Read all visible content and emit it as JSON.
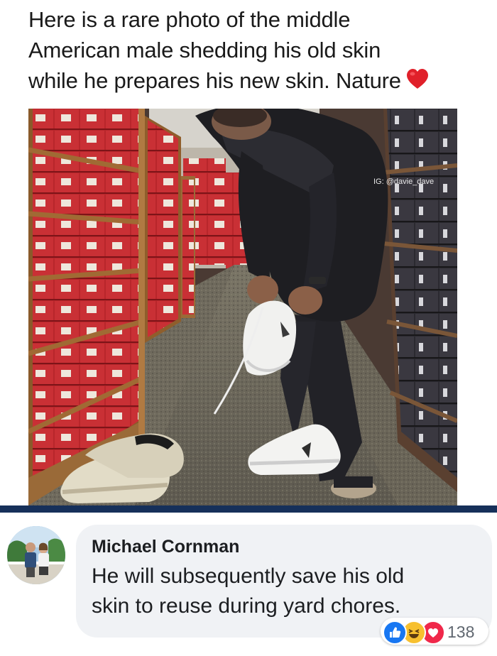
{
  "meme": {
    "caption_lines": [
      "Here is a rare photo of the middle",
      "American male shedding his old skin",
      "while he prepares his new skin. Nature"
    ],
    "caption_emoji": "heart-icon",
    "photo": {
      "watermark": "IG: @davie_dave"
    }
  },
  "comment": {
    "author": "Michael Cornman",
    "text_lines": [
      "He will subsequently save his old",
      "skin to reuse during yard chores."
    ],
    "reactions": {
      "types": [
        "like-icon",
        "haha-icon",
        "love-icon"
      ],
      "count": "138"
    }
  },
  "colors": {
    "divider": "#16305a",
    "bubble": "#f0f2f5",
    "like": "#1877f2",
    "haha": "#f7c02f",
    "love": "#f0284a"
  }
}
